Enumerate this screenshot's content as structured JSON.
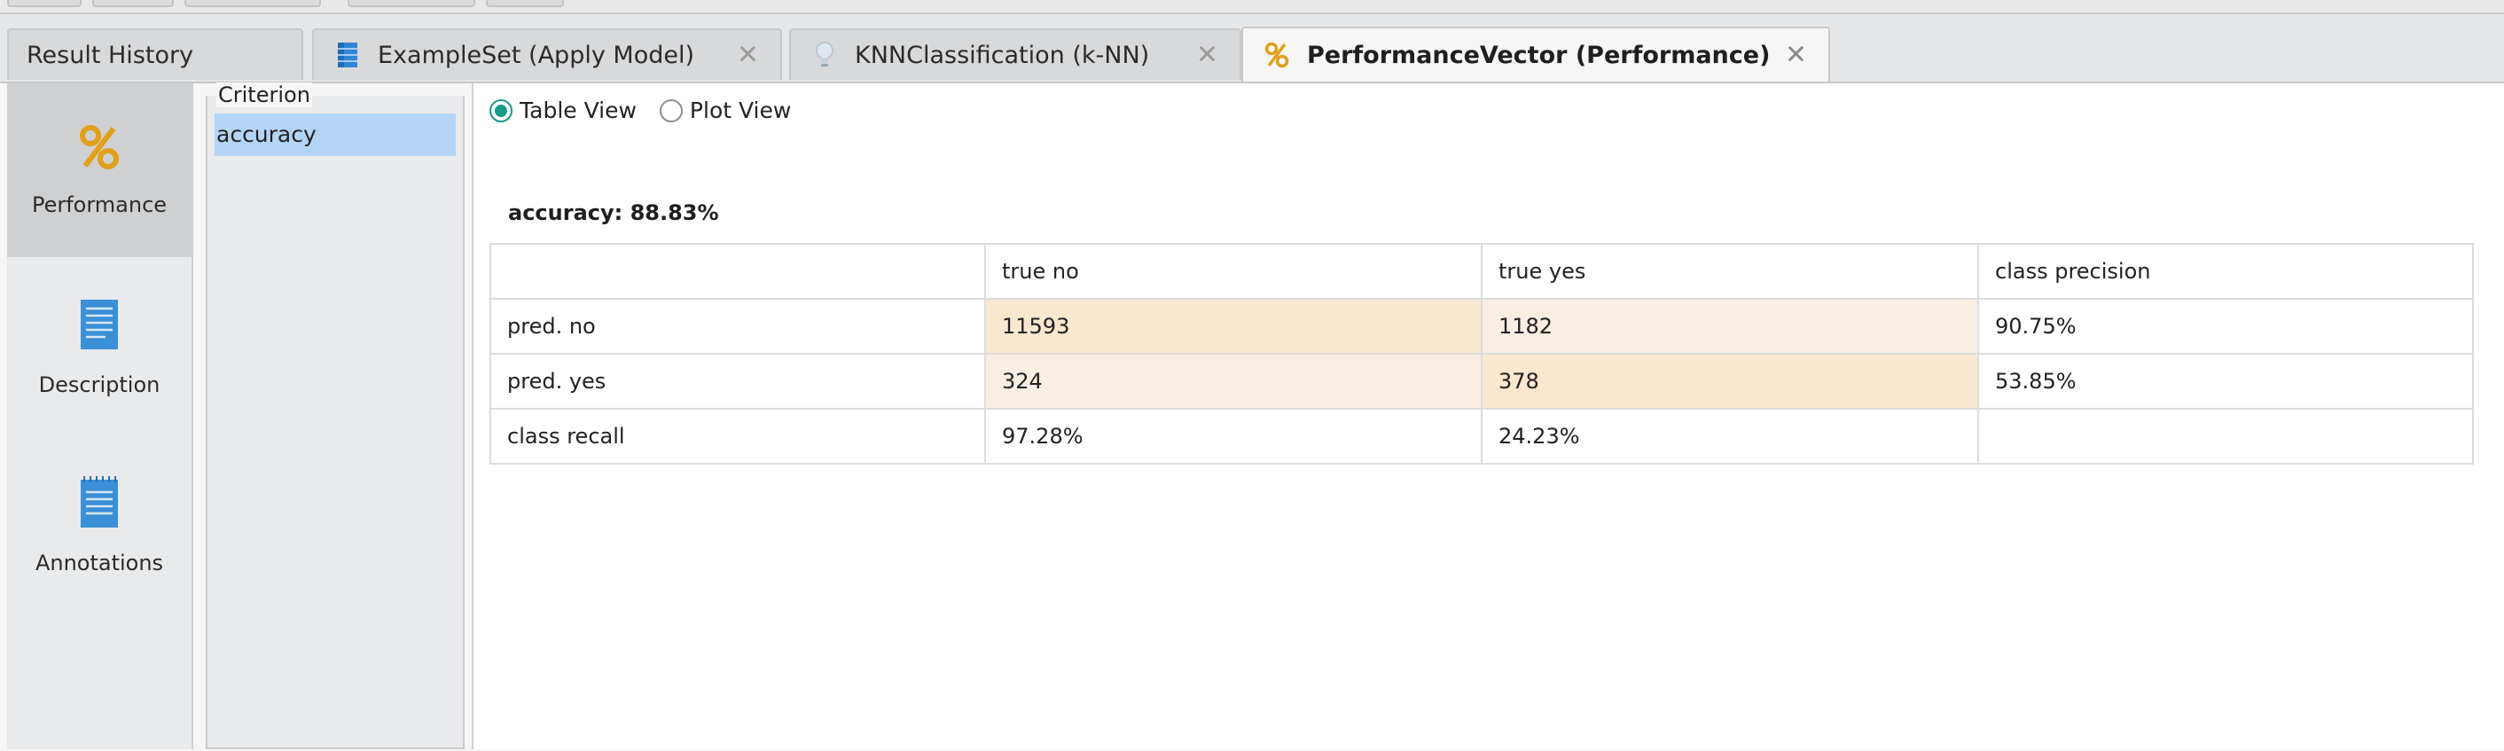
{
  "tabs": [
    {
      "label": "Result History",
      "icon": "none",
      "closable": false,
      "active": false
    },
    {
      "label": "ExampleSet (Apply Model)",
      "icon": "table-icon",
      "closable": true,
      "active": false
    },
    {
      "label": "KNNClassification (k-NN)",
      "icon": "lightbulb-icon",
      "closable": true,
      "active": false
    },
    {
      "label": "PerformanceVector (Performance)",
      "icon": "percent-icon",
      "closable": true,
      "active": true
    }
  ],
  "close_glyph": "✕",
  "nav": [
    {
      "label": "Performance",
      "icon": "percent-icon",
      "active": true
    },
    {
      "label": "Description",
      "icon": "document-icon",
      "active": false
    },
    {
      "label": "Annotations",
      "icon": "notepad-icon",
      "active": false
    }
  ],
  "criterion": {
    "legend": "Criterion",
    "items": [
      "accuracy"
    ],
    "selected": "accuracy"
  },
  "view": {
    "options": [
      "Table View",
      "Plot View"
    ],
    "selected": "Table View"
  },
  "performance": {
    "title": "accuracy: 88.83%",
    "header": [
      "",
      "true no",
      "true yes",
      "class precision"
    ],
    "rows": [
      [
        "pred. no",
        "11593",
        "1182",
        "90.75%"
      ],
      [
        "pred. yes",
        "324",
        "378",
        "53.85%"
      ],
      [
        "class recall",
        "97.28%",
        "24.23%",
        ""
      ]
    ]
  },
  "colors": {
    "accent": "#1a9b8a",
    "selection": "#b4d4f5",
    "cell_strong": "#f9e7cf",
    "cell_light": "#f8eee2",
    "percent_icon": "#e0a019",
    "doc_icon": "#3a8fd6"
  }
}
